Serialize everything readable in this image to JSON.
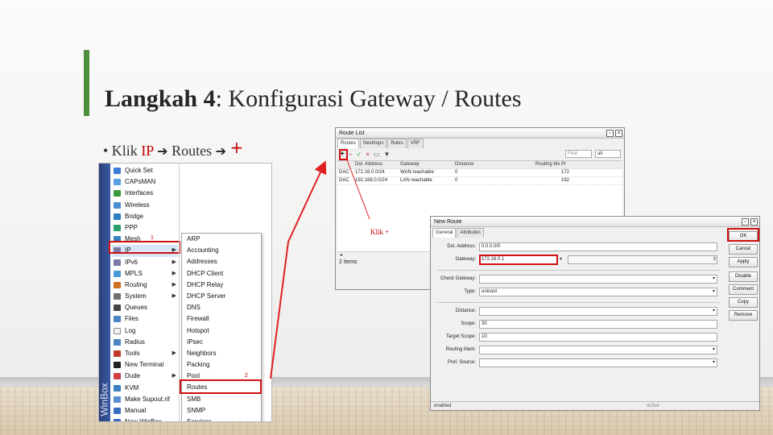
{
  "slide": {
    "title_bold": "Langkah 4",
    "title_rest": ": Konfigurasi Gateway / Routes",
    "bullet": {
      "prefix": "• Klik ",
      "ip": "IP",
      "arrow": "➔",
      "routes": "Routes",
      "plus": "+"
    },
    "klik_label": "Klik +"
  },
  "winbox_menu": {
    "brand": "WinBox",
    "items": [
      {
        "label": "Quick Set",
        "icon": "quick-set-icon",
        "color": "#3b7dd8"
      },
      {
        "label": "CAPsMAN",
        "icon": "capsman-icon",
        "color": "#5aa0e0"
      },
      {
        "label": "Interfaces",
        "icon": "interfaces-icon",
        "color": "#3a9a3a"
      },
      {
        "label": "Wireless",
        "icon": "wireless-icon",
        "color": "#4a8fd0"
      },
      {
        "label": "Bridge",
        "icon": "bridge-icon",
        "color": "#2d7fc4"
      },
      {
        "label": "PPP",
        "icon": "ppp-icon",
        "color": "#2d9f6a"
      },
      {
        "label": "Mesh",
        "icon": "mesh-icon",
        "color": "#3a7fc0",
        "num": "1"
      },
      {
        "label": "IP",
        "icon": "ip-icon",
        "color": "#7a7aa8",
        "arrow": true
      },
      {
        "label": "IPv6",
        "icon": "ipv6-icon",
        "color": "#7a7aa8",
        "arrow": true
      },
      {
        "label": "MPLS",
        "icon": "mpls-icon",
        "color": "#4a9ad8",
        "arrow": true
      },
      {
        "label": "Routing",
        "icon": "routing-icon",
        "color": "#d07020",
        "arrow": true
      },
      {
        "label": "System",
        "icon": "system-icon",
        "color": "#707070",
        "arrow": true
      },
      {
        "label": "Queues",
        "icon": "queues-icon",
        "color": "#444444"
      },
      {
        "label": "Files",
        "icon": "files-icon",
        "color": "#4f84c4"
      },
      {
        "label": "Log",
        "icon": "log-icon",
        "color": "#f2f2f2"
      },
      {
        "label": "Radius",
        "icon": "radius-icon",
        "color": "#4f84c4"
      },
      {
        "label": "Tools",
        "icon": "tools-icon",
        "color": "#c23a2a",
        "arrow": true
      },
      {
        "label": "New Terminal",
        "icon": "terminal-icon",
        "color": "#222222"
      },
      {
        "label": "Dude",
        "icon": "dude-icon",
        "color": "#d04040",
        "arrow": true
      },
      {
        "label": "KVM",
        "icon": "kvm-icon",
        "color": "#3a7fc0"
      },
      {
        "label": "Make Supout.rif",
        "icon": "supout-icon",
        "color": "#5a8fcf"
      },
      {
        "label": "Manual",
        "icon": "manual-icon",
        "color": "#3a6fc0"
      },
      {
        "label": "New WinBox",
        "icon": "winbox-icon",
        "color": "#3a6fc0"
      }
    ],
    "submenu": [
      {
        "label": "ARP"
      },
      {
        "label": "Accounting"
      },
      {
        "label": "Addresses"
      },
      {
        "label": "DHCP Client"
      },
      {
        "label": "DHCP Relay"
      },
      {
        "label": "DHCP Server"
      },
      {
        "label": "DNS"
      },
      {
        "label": "Firewall"
      },
      {
        "label": "Hotspot"
      },
      {
        "label": "IPsec"
      },
      {
        "label": "Neighbors"
      },
      {
        "label": "Packing"
      },
      {
        "label": "Pool",
        "num": "2"
      },
      {
        "label": "Routes"
      },
      {
        "label": "SMB"
      },
      {
        "label": "SNMP"
      },
      {
        "label": "Services"
      }
    ]
  },
  "route_list": {
    "title": "Route List",
    "tabs": [
      "Routes",
      "Nexthops",
      "Rules",
      "VRF"
    ],
    "find_placeholder": "Find",
    "filter_value": "all",
    "columns": [
      "",
      "Dst. Address",
      "Gateway",
      "Distance",
      "Routing Mark",
      "Pr"
    ],
    "rows": [
      {
        "flag": "DAC",
        "dst": "172.16.0.0/24",
        "gateway": "WAN reachable",
        "distance": "0",
        "mark": "",
        "pref": "172"
      },
      {
        "flag": "DAC",
        "dst": "192.168.0.0/24",
        "gateway": "LAN reachable",
        "distance": "0",
        "mark": "",
        "pref": "192"
      }
    ],
    "status": "2 items"
  },
  "new_route": {
    "title": "New Route",
    "tabs": [
      "General",
      "Attributes"
    ],
    "fields": {
      "dst_label": "Dst. Address:",
      "dst_value": "0.0.0.0/0",
      "gateway_label": "Gateway:",
      "gateway_value": "172.16.0.1",
      "check_gateway_label": "Check Gateway:",
      "type_label": "Type:",
      "type_value": "unicast",
      "distance_label": "Distance:",
      "scope_label": "Scope:",
      "scope_value": "30",
      "target_scope_label": "Target Scope:",
      "target_scope_value": "10",
      "routing_mark_label": "Routing Mark:",
      "pref_source_label": "Pref. Source:"
    },
    "buttons": [
      "OK",
      "Cancel",
      "Apply",
      "Disable",
      "Comment",
      "Copy",
      "Remove"
    ],
    "status_left": "enabled",
    "status_right": "active"
  },
  "colors": {
    "accent_green": "#4e8f3c",
    "highlight_red": "#d01010",
    "winbox_blue": "#2a3f78"
  }
}
